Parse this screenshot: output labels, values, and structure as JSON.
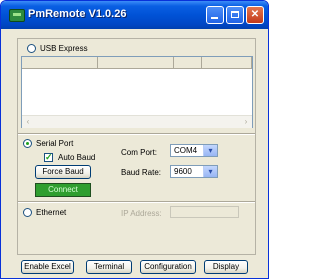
{
  "window": {
    "title": "PmRemote  V1.0.26",
    "min_glyph": "",
    "max_glyph": "",
    "close_glyph": "✕"
  },
  "usb": {
    "label": "USB Express",
    "selected": false
  },
  "grid": {
    "scroll_left": "‹",
    "scroll_right": "›"
  },
  "serial": {
    "label": "Serial Port",
    "selected": true,
    "auto_baud_label": "Auto Baud",
    "auto_baud_checked": true,
    "force_baud_label": "Force Baud",
    "connect_label": "Connect",
    "com_port_label": "Com Port:",
    "com_port_value": "COM4",
    "baud_rate_label": "Baud Rate:",
    "baud_rate_value": "9600",
    "dropdown_arrow": "▾"
  },
  "ethernet": {
    "label": "Ethernet",
    "selected": false,
    "ip_label": "IP Address:",
    "ip_value": ""
  },
  "footer": {
    "enable_excel": "Enable Excel",
    "terminal": "Terminal",
    "configuration": "Configuration",
    "display": "Display"
  },
  "colors": {
    "titlebar": "#0052d6",
    "window_bg": "#ece9d8",
    "connect_green": "#2f9e2f",
    "radio_dot": "#21a121"
  }
}
